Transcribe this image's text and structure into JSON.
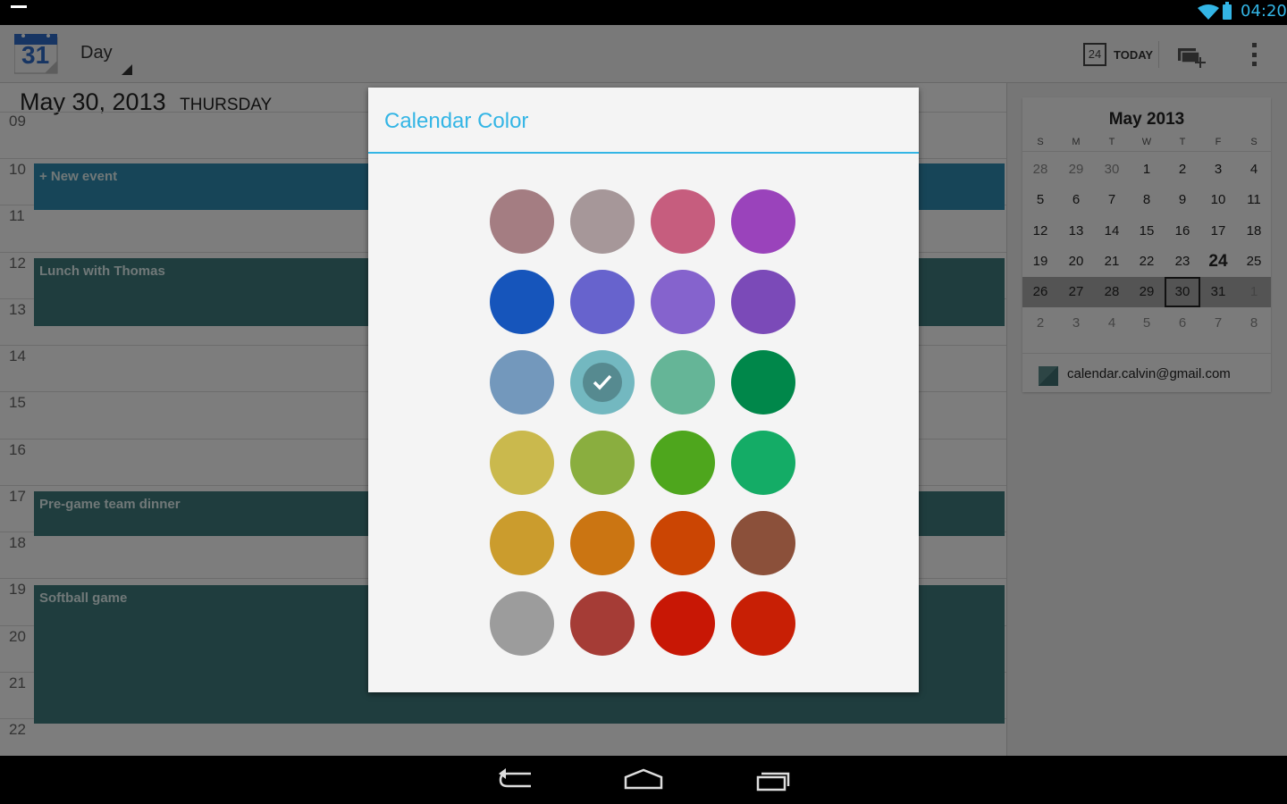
{
  "status_bar": {
    "time": "04:20"
  },
  "action_bar": {
    "app_icon_day": "31",
    "view_select": "Day",
    "today_icon_day": "24",
    "today_label": "TODAY"
  },
  "day_view": {
    "date": "May 30, 2013",
    "weekday": "THURSDAY",
    "hours": [
      "09",
      "10",
      "11",
      "12",
      "13",
      "14",
      "15",
      "16",
      "17",
      "18",
      "19",
      "20",
      "21",
      "22"
    ],
    "events": [
      {
        "title": "+ New event",
        "color": "#2e8ab0"
      },
      {
        "title": "Lunch with Thomas",
        "color": "#3f7a7c"
      },
      {
        "title": "Pre-game team dinner",
        "color": "#3f7a7c"
      },
      {
        "title": "Softball game",
        "color": "#3f7a7c"
      }
    ]
  },
  "mini_calendar": {
    "title": "May 2013",
    "weekdays": [
      "S",
      "M",
      "T",
      "W",
      "T",
      "F",
      "S"
    ],
    "weeks": [
      [
        "28",
        "29",
        "30",
        "1",
        "2",
        "3",
        "4"
      ],
      [
        "5",
        "6",
        "7",
        "8",
        "9",
        "10",
        "11"
      ],
      [
        "12",
        "13",
        "14",
        "15",
        "16",
        "17",
        "18"
      ],
      [
        "19",
        "20",
        "21",
        "22",
        "23",
        "24",
        "25"
      ],
      [
        "26",
        "27",
        "28",
        "29",
        "30",
        "31",
        "1"
      ],
      [
        "2",
        "3",
        "4",
        "5",
        "6",
        "7",
        "8"
      ]
    ],
    "account_email": "calendar.calvin@gmail.com"
  },
  "dialog": {
    "title": "Calendar Color",
    "accent": "#33b5e5",
    "selected_index": 9,
    "colors": [
      "#a47d82",
      "#a69799",
      "#c65d7e",
      "#9a43bb",
      "#1655bb",
      "#6763cd",
      "#8563cd",
      "#7b4ab8",
      "#7398bc",
      "#73b8c0",
      "#65b597",
      "#00874a",
      "#cab94d",
      "#8aae3f",
      "#4ea61d",
      "#14ac66",
      "#cb9c2d",
      "#cb7512",
      "#cb4503",
      "#8b503a",
      "#9c9c9c",
      "#a53c36",
      "#c81705",
      "#c81f05"
    ]
  },
  "nav_bar": {
    "buttons": [
      "back-icon",
      "home-icon",
      "recents-icon"
    ]
  }
}
